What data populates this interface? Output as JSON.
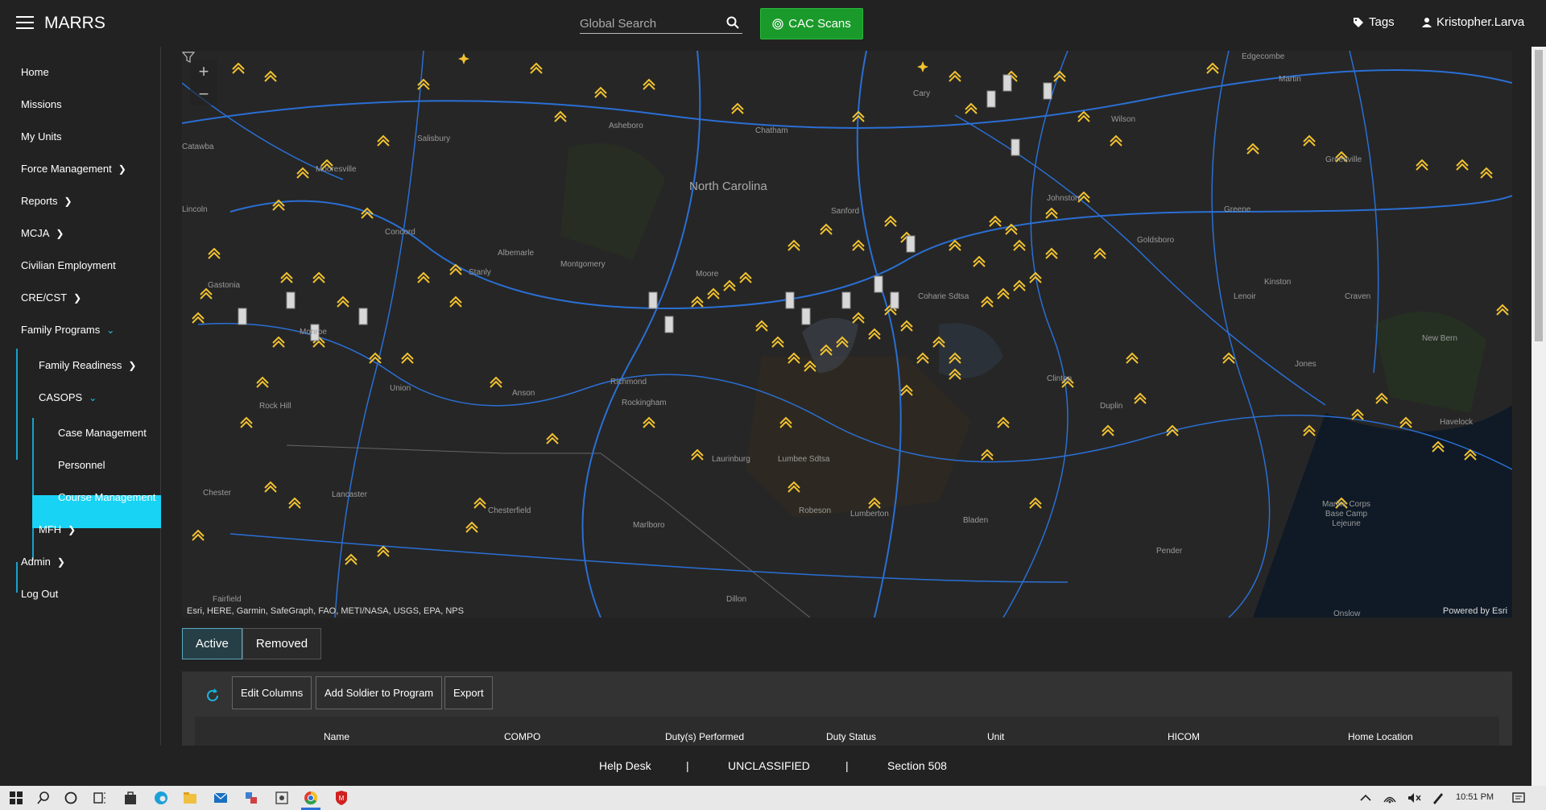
{
  "app": {
    "title": "MARRS"
  },
  "header": {
    "search_placeholder": "Global Search",
    "cac_label": "CAC Scans",
    "tags_label": "Tags",
    "user_label": "Kristopher.Larva"
  },
  "sidebar": {
    "items": [
      {
        "label": "Home"
      },
      {
        "label": "Missions"
      },
      {
        "label": "My Units"
      },
      {
        "label": "Force Management"
      },
      {
        "label": "Reports"
      },
      {
        "label": "MCJA"
      },
      {
        "label": "Civilian Employment"
      },
      {
        "label": "CRE/CST"
      },
      {
        "label": "Family Programs"
      },
      {
        "label": "Family Readiness"
      },
      {
        "label": "CASOPS"
      },
      {
        "label": "Case Management"
      },
      {
        "label": "Personnel"
      },
      {
        "label": "Course Management"
      },
      {
        "label": "MFH"
      },
      {
        "label": "Admin"
      },
      {
        "label": "Log Out"
      }
    ]
  },
  "map": {
    "attribution": "Esri, HERE, Garmin, SafeGraph, FAO, METI/NASA, USGS, EPA, NPS",
    "powered_by": "Powered by Esri",
    "labels": [
      "North Carolina",
      "Sanford",
      "Albemarle",
      "Concord",
      "Mooresville",
      "Salisbury",
      "Gastonia",
      "Rock Hill",
      "Lancaster",
      "Chester",
      "Monroe",
      "Rockingham",
      "Richmond",
      "Anson",
      "Laurinburg",
      "Lumbee Sdtsa",
      "Robeson",
      "Lumberton",
      "Coharie Sdtsa",
      "Clinton",
      "Duplin",
      "Kinston",
      "Jones",
      "New Bern",
      "Havelock",
      "Goldsboro",
      "Wilson",
      "Greenville",
      "Johnston",
      "Cary",
      "Chatham",
      "Moore",
      "Montgomery",
      "Stanly",
      "Chesterfield",
      "Marlboro",
      "Dillon",
      "Bladen",
      "Pender",
      "Marine Corps Base Camp Lejeune",
      "Asheboro",
      "Lincoln",
      "Catawba",
      "Union",
      "Craven",
      "Lenoir",
      "Greene",
      "Martin",
      "Edgecombe",
      "Fairfield",
      "Onslow"
    ]
  },
  "tabs": {
    "active": "Active",
    "removed": "Removed"
  },
  "toolbar": {
    "edit_columns": "Edit Columns",
    "add_soldier": "Add Soldier to Program",
    "export": "Export"
  },
  "table": {
    "columns": [
      "Name",
      "COMPO",
      "Duty(s) Performed",
      "Duty Status",
      "Unit",
      "HICOM",
      "Home Location"
    ]
  },
  "footer": {
    "help": "Help Desk",
    "sep1": "|",
    "classification": "UNCLASSIFIED",
    "sep2": "|",
    "section": "Section 508"
  },
  "taskbar": {
    "time": "10:51 PM"
  },
  "colors": {
    "accent": "#19d3f5",
    "cac_green": "#1a9a2a",
    "map_bg": "#262626",
    "road": "#2a6fd4"
  }
}
